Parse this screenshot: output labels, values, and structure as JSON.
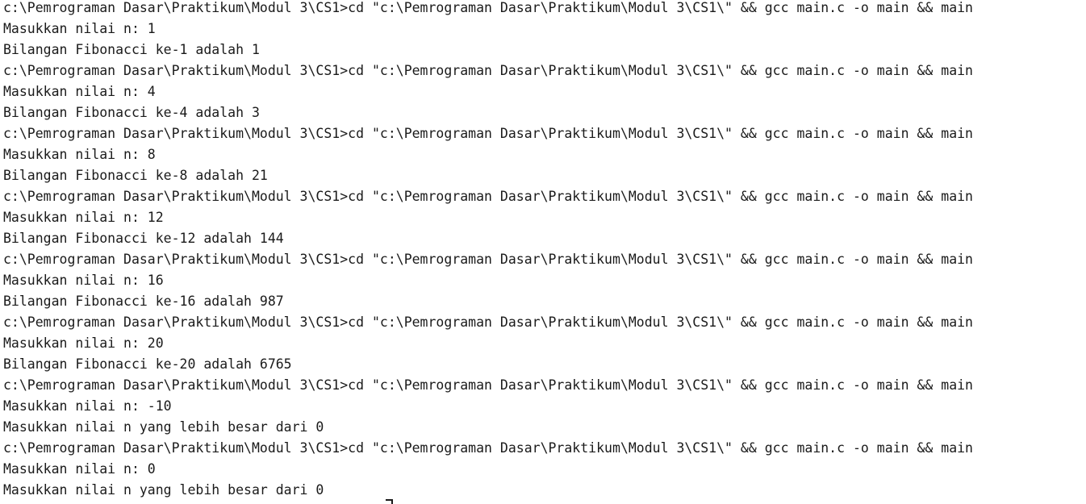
{
  "terminal": {
    "lines": [
      "c:\\Pemrograman Dasar\\Praktikum\\Modul 3\\CS1>cd \"c:\\Pemrograman Dasar\\Praktikum\\Modul 3\\CS1\\\" && gcc main.c -o main && main",
      "Masukkan nilai n: 1",
      "Bilangan Fibonacci ke-1 adalah 1",
      "c:\\Pemrograman Dasar\\Praktikum\\Modul 3\\CS1>cd \"c:\\Pemrograman Dasar\\Praktikum\\Modul 3\\CS1\\\" && gcc main.c -o main && main",
      "Masukkan nilai n: 4",
      "Bilangan Fibonacci ke-4 adalah 3",
      "c:\\Pemrograman Dasar\\Praktikum\\Modul 3\\CS1>cd \"c:\\Pemrograman Dasar\\Praktikum\\Modul 3\\CS1\\\" && gcc main.c -o main && main",
      "Masukkan nilai n: 8",
      "Bilangan Fibonacci ke-8 adalah 21",
      "c:\\Pemrograman Dasar\\Praktikum\\Modul 3\\CS1>cd \"c:\\Pemrograman Dasar\\Praktikum\\Modul 3\\CS1\\\" && gcc main.c -o main && main",
      "Masukkan nilai n: 12",
      "Bilangan Fibonacci ke-12 adalah 144",
      "c:\\Pemrograman Dasar\\Praktikum\\Modul 3\\CS1>cd \"c:\\Pemrograman Dasar\\Praktikum\\Modul 3\\CS1\\\" && gcc main.c -o main && main",
      "Masukkan nilai n: 16",
      "Bilangan Fibonacci ke-16 adalah 987",
      "c:\\Pemrograman Dasar\\Praktikum\\Modul 3\\CS1>cd \"c:\\Pemrograman Dasar\\Praktikum\\Modul 3\\CS1\\\" && gcc main.c -o main && main",
      "Masukkan nilai n: 20",
      "Bilangan Fibonacci ke-20 adalah 6765",
      "c:\\Pemrograman Dasar\\Praktikum\\Modul 3\\CS1>cd \"c:\\Pemrograman Dasar\\Praktikum\\Modul 3\\CS1\\\" && gcc main.c -o main && main",
      "Masukkan nilai n: -10",
      "Masukkan nilai n yang lebih besar dari 0",
      "c:\\Pemrograman Dasar\\Praktikum\\Modul 3\\CS1>cd \"c:\\Pemrograman Dasar\\Praktikum\\Modul 3\\CS1\\\" && gcc main.c -o main && main",
      "Masukkan nilai n: 0",
      "Masukkan nilai n yang lebih besar dari 0"
    ]
  },
  "colors": {
    "background": "#ffffff",
    "text": "#1a1a1a"
  }
}
